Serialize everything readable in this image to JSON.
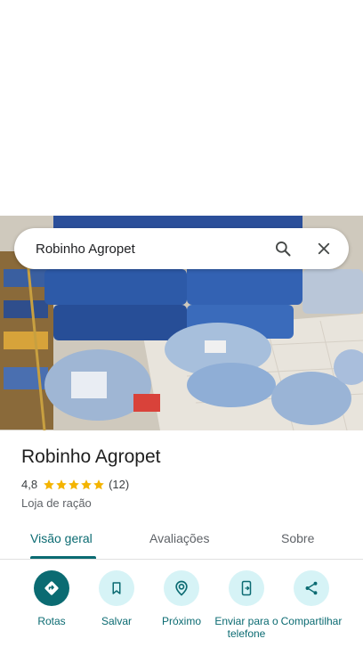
{
  "search": {
    "query": "Robinho Agropet"
  },
  "place": {
    "name": "Robinho Agropet",
    "rating": "4,8",
    "stars": 5,
    "review_count": "(12)",
    "category": "Loja de ração"
  },
  "tabs": [
    {
      "label": "Visão geral",
      "active": true
    },
    {
      "label": "Avaliações",
      "active": false
    },
    {
      "label": "Sobre",
      "active": false
    }
  ],
  "actions": [
    {
      "label": "Rotas",
      "icon": "directions-icon"
    },
    {
      "label": "Salvar",
      "icon": "bookmark-icon"
    },
    {
      "label": "Próximo",
      "icon": "nearby-icon"
    },
    {
      "label": "Enviar para o telefone",
      "icon": "send-to-phone-icon"
    },
    {
      "label": "Compartilhar",
      "icon": "share-icon"
    }
  ],
  "colors": {
    "accent": "#0b6b72",
    "accent_light": "#d6f3f6",
    "star": "#f4b400"
  }
}
